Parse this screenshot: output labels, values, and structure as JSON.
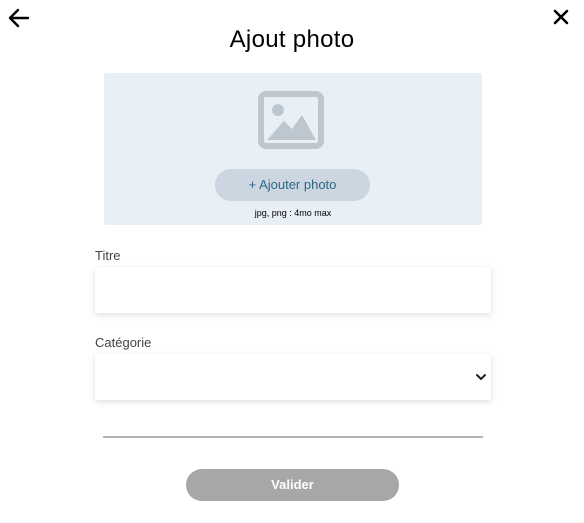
{
  "header": {
    "title": "Ajout photo",
    "back_icon": "arrow-left-icon",
    "close_icon": "close-icon"
  },
  "upload": {
    "placeholder_icon": "image-placeholder-icon",
    "button_label": "+ Ajouter photo",
    "hint": "jpg, png : 4mo max"
  },
  "form": {
    "title_label": "Titre",
    "title_value": "",
    "category_label": "Catégorie",
    "category_value": "",
    "chevron_icon": "chevron-down-icon"
  },
  "actions": {
    "submit_label": "Valider"
  },
  "colors": {
    "upload_bg": "#e8f0f6",
    "upload_button_bg": "#cbd6e0",
    "upload_button_text": "#306685",
    "submit_bg": "#a7a7a7",
    "divider": "#b4b4b4"
  }
}
